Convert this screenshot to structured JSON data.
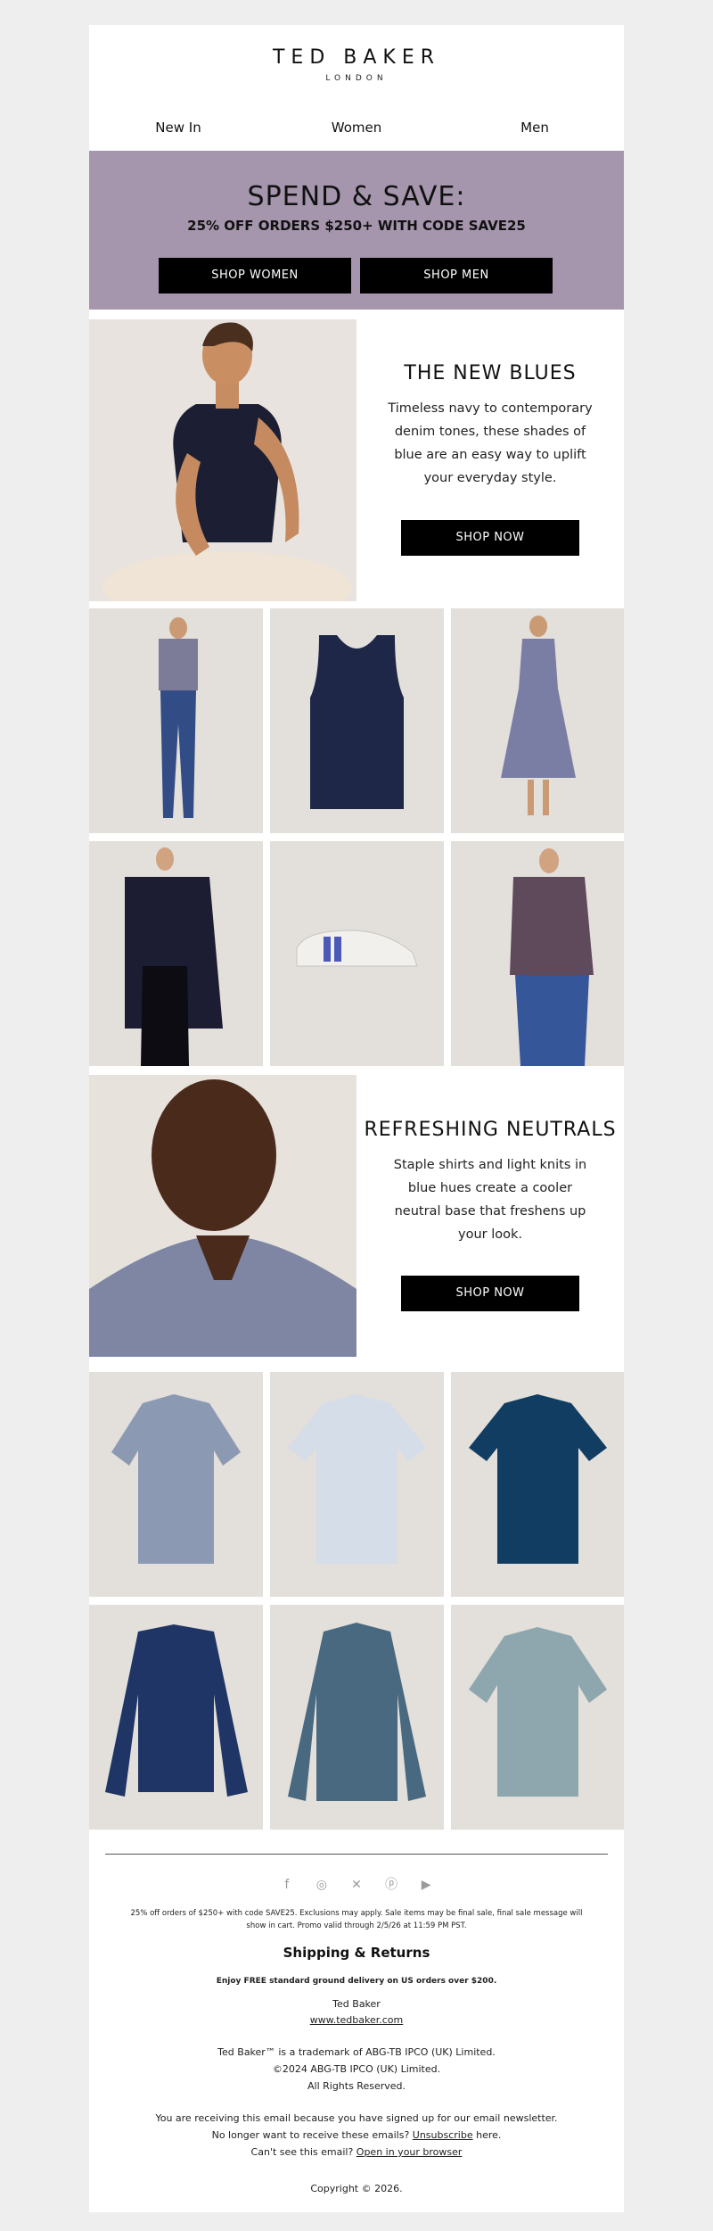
{
  "brand": {
    "name": "TED BAKER",
    "sub": "LONDON"
  },
  "nav": [
    {
      "label": "New In"
    },
    {
      "label": "Women"
    },
    {
      "label": "Men"
    }
  ],
  "promo": {
    "headline": "SPEND & SAVE:",
    "subline": "25% OFF ORDERS $250+ WITH CODE SAVE25",
    "btn_women": "SHOP WOMEN",
    "btn_men": "SHOP MEN",
    "bg": "#a595ad"
  },
  "blues": {
    "title": "THE NEW BLUES",
    "desc": "Timeless navy to contemporary denim tones, these shades of blue are an easy way to uplift your everyday style.",
    "cta": "SHOP NOW"
  },
  "neutrals": {
    "title": "REFRESHING NEUTRALS",
    "desc": "Staple shirts and light knits in blue hues create a cooler neutral base that freshens up your look.",
    "cta": "SHOP NOW"
  },
  "footer": {
    "disclaimer": "25% off orders of $250+ with code SAVE25. Exclusions may apply. Sale items may be final sale, final sale message will show in cart. Promo valid through 2/5/26 at 11:59 PM PST.",
    "shipping_title": "Shipping & Returns",
    "shipping_text": "Enjoy FREE standard ground delivery on US orders over $200.",
    "company": "Ted Baker",
    "website": "www.tedbaker.com",
    "trademark": "Ted Baker™ is a trademark of ABG-TB IPCO (UK) Limited.",
    "copyright_ipco": "©2024 ABG-TB IPCO (UK) Limited.",
    "rights": "All Rights Reserved.",
    "receiving": "You are receiving this email because you have signed up for our email newsletter.",
    "unsub_pre": "No longer want to receive these emails?",
    "unsub_link": "Unsubscribe",
    "unsub_post": "here.",
    "view_pre": "Can't see this email?",
    "view_link": "Open in your browser",
    "copyright": "Copyright © 2026."
  },
  "social": [
    "facebook-icon",
    "instagram-icon",
    "x-icon",
    "pinterest-icon",
    "youtube-icon"
  ]
}
